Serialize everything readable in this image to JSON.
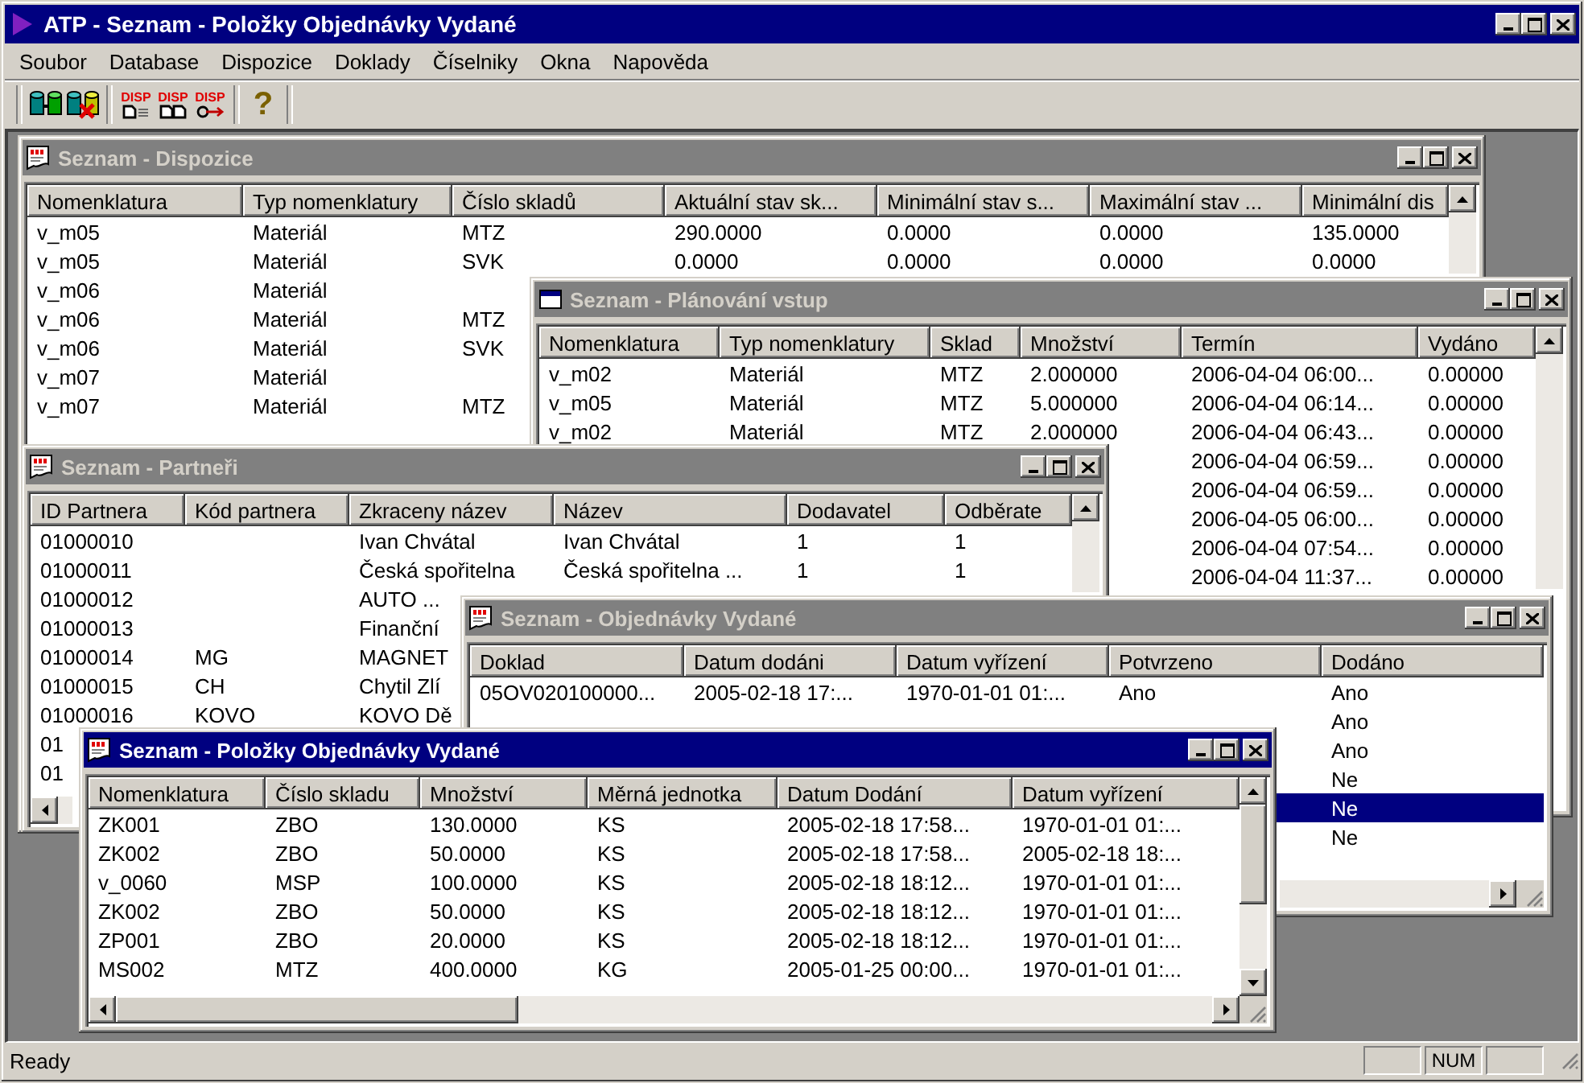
{
  "window": {
    "title": "ATP - Seznam - Položky Objednávky Vydané"
  },
  "menu": [
    "Soubor",
    "Database",
    "Dispozice",
    "Doklady",
    "Číselniky",
    "Okna",
    "Napověda"
  ],
  "toolbar": {
    "groups": [
      [
        {
          "kind": "db"
        },
        {
          "kind": "db-remove"
        }
      ],
      [
        {
          "kind": "disp-list",
          "label": "DISP"
        },
        {
          "kind": "disp-docs",
          "label": "DISP"
        },
        {
          "kind": "disp-arrow",
          "label": "DISP"
        }
      ],
      [
        {
          "kind": "help",
          "label": "?"
        }
      ]
    ]
  },
  "windows": [
    {
      "title": "Seznam - Dispozice",
      "active": false,
      "columns": [
        "Nomenklatura",
        "Typ nomenklatury",
        "Číslo skladů",
        "Aktuální stav sk...",
        "Minimální stav s...",
        "Maximální stav ...",
        "Minimální dis"
      ],
      "rows": [
        {
          "cells": [
            "v_m05",
            "Materiál",
            "MTZ",
            "290.0000",
            "0.0000",
            "0.0000",
            "135.0000"
          ]
        },
        {
          "cells": [
            "v_m05",
            "Materiál",
            "SVK",
            "0.0000",
            "0.0000",
            "0.0000",
            "0.0000"
          ]
        },
        {
          "cells": [
            "v_m06",
            "Materiál",
            null
          ]
        },
        {
          "cells": [
            "v_m06",
            "Materiál",
            "MTZ"
          ]
        },
        {
          "cells": [
            "v_m06",
            "Materiál",
            "SVK"
          ]
        },
        {
          "cells": [
            "v_m07",
            "Materiál",
            null
          ]
        },
        {
          "cells": [
            "v_m07",
            "Materiál",
            "MTZ"
          ]
        }
      ]
    },
    {
      "title": "Seznam - Plánování vstup",
      "active": false,
      "columns": [
        "Nomenklatura",
        "Typ nomenklatury",
        "Sklad",
        "Množství",
        "Termín",
        "Vydáno"
      ],
      "rows": [
        {
          "cells": [
            "v_m02",
            "Materiál",
            "MTZ",
            "2.000000",
            "2006-04-04 06:00...",
            "0.00000"
          ]
        },
        {
          "cells": [
            "v_m05",
            "Materiál",
            "MTZ",
            "5.000000",
            "2006-04-04 06:14...",
            "0.00000"
          ]
        },
        {
          "cells": [
            "v_m02",
            "Materiál",
            "MTZ",
            "2.000000",
            "2006-04-04 06:43...",
            "0.00000"
          ]
        },
        {
          "cells": [
            null,
            null,
            null,
            null,
            "2006-04-04 06:59...",
            "0.00000"
          ]
        },
        {
          "cells": [
            null,
            null,
            null,
            null,
            "2006-04-04 06:59...",
            "0.00000"
          ]
        },
        {
          "cells": [
            null,
            null,
            null,
            null,
            "2006-04-05 06:00...",
            "0.00000"
          ]
        },
        {
          "cells": [
            null,
            null,
            null,
            null,
            "2006-04-04 07:54...",
            "0.00000"
          ]
        },
        {
          "cells": [
            null,
            null,
            null,
            null,
            "2006-04-04 11:37...",
            "0.00000"
          ]
        }
      ]
    },
    {
      "title": "Seznam - Partneři",
      "active": false,
      "columns": [
        "ID Partnera",
        "Kód partnera",
        "Zkraceny název",
        "Název",
        "Dodavatel",
        "Odběrate"
      ],
      "rows": [
        {
          "cells": [
            "01000010",
            null,
            "Ivan Chvátal",
            "Ivan Chvátal",
            "1",
            "1"
          ]
        },
        {
          "cells": [
            "01000011",
            null,
            "Česká spořitelna",
            "Česká spořitelna ...",
            "1",
            "1"
          ]
        },
        {
          "cells": [
            "01000012",
            null,
            "AUTO ..."
          ]
        },
        {
          "cells": [
            "01000013",
            null,
            "Finanční"
          ]
        },
        {
          "cells": [
            "01000014",
            "MG",
            "MAGNET"
          ]
        },
        {
          "cells": [
            "01000015",
            "CH",
            "Chytil Zlí"
          ]
        },
        {
          "cells": [
            "01000016",
            "KOVO",
            "KOVO Dě"
          ]
        },
        {
          "cells": [
            "01"
          ]
        },
        {
          "cells": [
            "01"
          ]
        }
      ]
    },
    {
      "title": "Seznam - Objednávky Vydané",
      "active": false,
      "columns": [
        "Doklad",
        "Datum dodáni",
        "Datum vyřízení",
        "Potvrzeno",
        "Dodáno"
      ],
      "rows": [
        {
          "cells": [
            "05OV020100000...",
            "2005-02-18 17:...",
            "1970-01-01 01:...",
            "Ano",
            "Ano"
          ],
          "selected": false
        },
        {
          "cells": [
            null,
            null,
            null,
            null,
            "Ano"
          ],
          "selected": false
        },
        {
          "cells": [
            null,
            null,
            null,
            null,
            "Ano"
          ],
          "selected": false
        },
        {
          "cells": [
            null,
            null,
            null,
            null,
            "Ne"
          ],
          "selected": false
        },
        {
          "cells": [
            null,
            null,
            null,
            null,
            "Ne"
          ],
          "selected": true
        },
        {
          "cells": [
            null,
            null,
            null,
            null,
            "Ne"
          ],
          "selected": false
        }
      ]
    },
    {
      "title": "Seznam - Položky Objednávky Vydané",
      "active": true,
      "columns": [
        "Nomenklatura",
        "Číslo skladu",
        "Množství",
        "Měrná jednotka",
        "Datum Dodání",
        "Datum vyřízení"
      ],
      "rows": [
        {
          "cells": [
            "ZK001",
            "ZBO",
            "130.0000",
            "KS",
            "2005-02-18 17:58...",
            "1970-01-01 01:..."
          ]
        },
        {
          "cells": [
            "ZK002",
            "ZBO",
            "50.0000",
            "KS",
            "2005-02-18 17:58...",
            "2005-02-18 18:..."
          ]
        },
        {
          "cells": [
            "v_0060",
            "MSP",
            "100.0000",
            "KS",
            "2005-02-18 18:12...",
            "1970-01-01 01:..."
          ]
        },
        {
          "cells": [
            "ZK002",
            "ZBO",
            "50.0000",
            "KS",
            "2005-02-18 18:12...",
            "1970-01-01 01:..."
          ]
        },
        {
          "cells": [
            "ZP001",
            "ZBO",
            "20.0000",
            "KS",
            "2005-02-18 18:12...",
            "1970-01-01 01:..."
          ]
        },
        {
          "cells": [
            "MS002",
            "MTZ",
            "400.0000",
            "KG",
            "2005-01-25 00:00...",
            "1970-01-01 01:..."
          ]
        }
      ]
    }
  ],
  "status_bar": {
    "text": "Ready",
    "indicators": [
      "NUM"
    ]
  }
}
